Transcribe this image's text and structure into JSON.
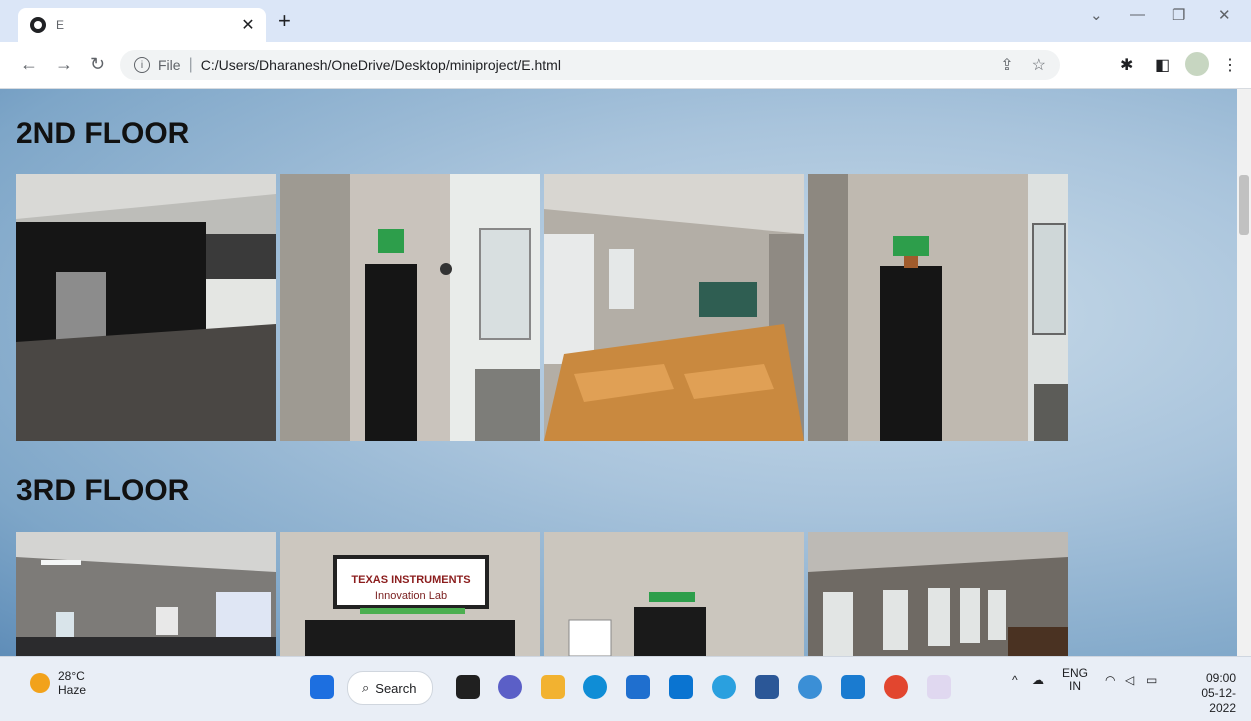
{
  "browser": {
    "tab_title": "E",
    "new_tab_label": "+",
    "url_label": "File",
    "url": "C:/Users/Dharanesh/OneDrive/Desktop/miniproject/E.html"
  },
  "page": {
    "floors": [
      {
        "title": "2ND FLOOR",
        "photos": [
          "lift-lobby-photo",
          "door-corridor-photo",
          "classroom-photo",
          "door-sign-photo"
        ]
      },
      {
        "title": "3RD FLOOR",
        "photos": [
          "hall-photo",
          "innovation-lab-photo",
          "door-room-photo",
          "lab-windows-photo"
        ]
      }
    ],
    "lab_sign": {
      "line1": "TEXAS INSTRUMENTS",
      "line2": "Innovation Lab"
    }
  },
  "taskbar": {
    "weather_temp": "28°C",
    "weather_desc": "Haze",
    "search_label": "Search",
    "lang_1": "ENG",
    "lang_2": "IN",
    "time": "09:00",
    "date": "05-12-2022"
  },
  "colors": {
    "page_bg": "#9fb9d3",
    "heading": "#111111"
  }
}
